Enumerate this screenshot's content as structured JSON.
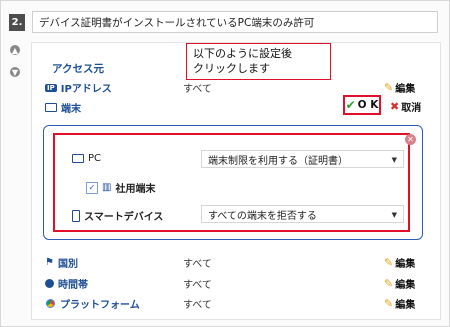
{
  "header": {
    "step": "2.",
    "title": "デバイス証明書がインストールされているPC端末のみ許可"
  },
  "section": {
    "title": "アクセス元"
  },
  "rows": [
    {
      "label": "IPアドレス",
      "value": "すべて",
      "edit": "編集"
    },
    {
      "label": "端末",
      "ok": "O K",
      "cancel": "取消"
    }
  ],
  "tooltip": {
    "text": "以下のように設定後\nクリックします"
  },
  "device": {
    "pc_label": "PC",
    "pc_select": "端末制限を利用する（証明書）",
    "company_label": "社用端末",
    "smart_label": "スマートデバイス",
    "smart_select": "すべての端末を拒否する"
  },
  "bottom_rows": [
    {
      "label": "国別",
      "value": "すべて",
      "edit": "編集"
    },
    {
      "label": "時間帯",
      "value": "すべて",
      "edit": "編集"
    },
    {
      "label": "プラットフォーム",
      "value": "すべて",
      "edit": "編集"
    }
  ],
  "colors": {
    "accent_blue": "#1e4f94",
    "highlight_red": "#e0102b",
    "ok_green": "#26a32e"
  }
}
